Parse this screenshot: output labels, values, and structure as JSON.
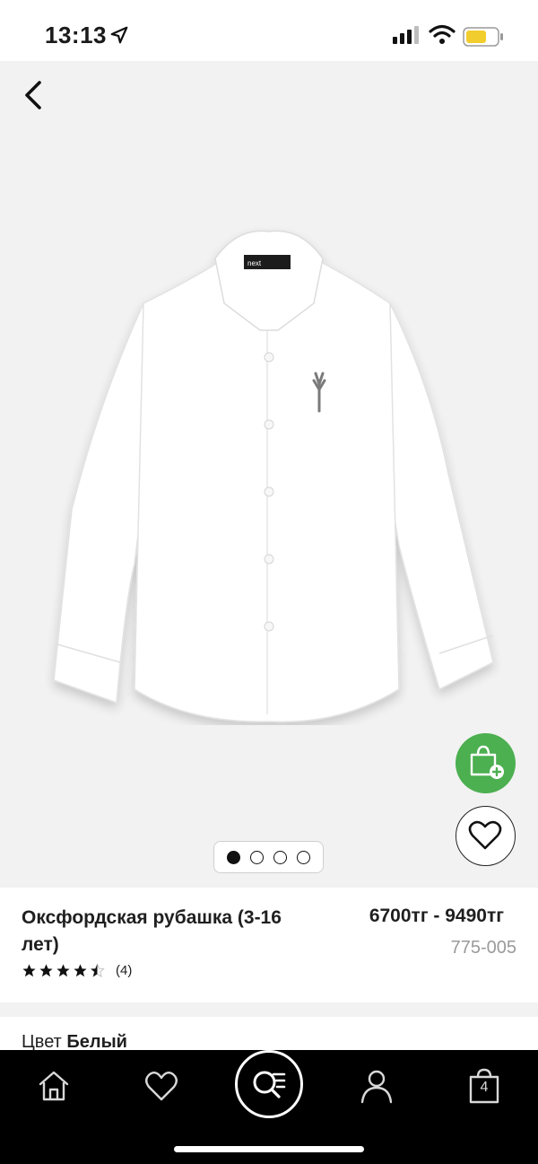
{
  "status_bar": {
    "time": "13:13"
  },
  "gallery": {
    "image_count": 4,
    "active_index": 0,
    "brand_tag": "next"
  },
  "product": {
    "title": "Оксфордская рубашка (3-16 лет)",
    "price": "6700тг - 9490тг",
    "sku": "775-005",
    "rating": 4.5,
    "review_count": "(4)"
  },
  "color": {
    "label": "Цвет",
    "value": "Белый"
  },
  "bottom_nav": {
    "bag_count": "4"
  },
  "colors": {
    "accent_green": "#4caf50",
    "nav_background": "#000000",
    "gallery_background": "#f2f2f2"
  }
}
